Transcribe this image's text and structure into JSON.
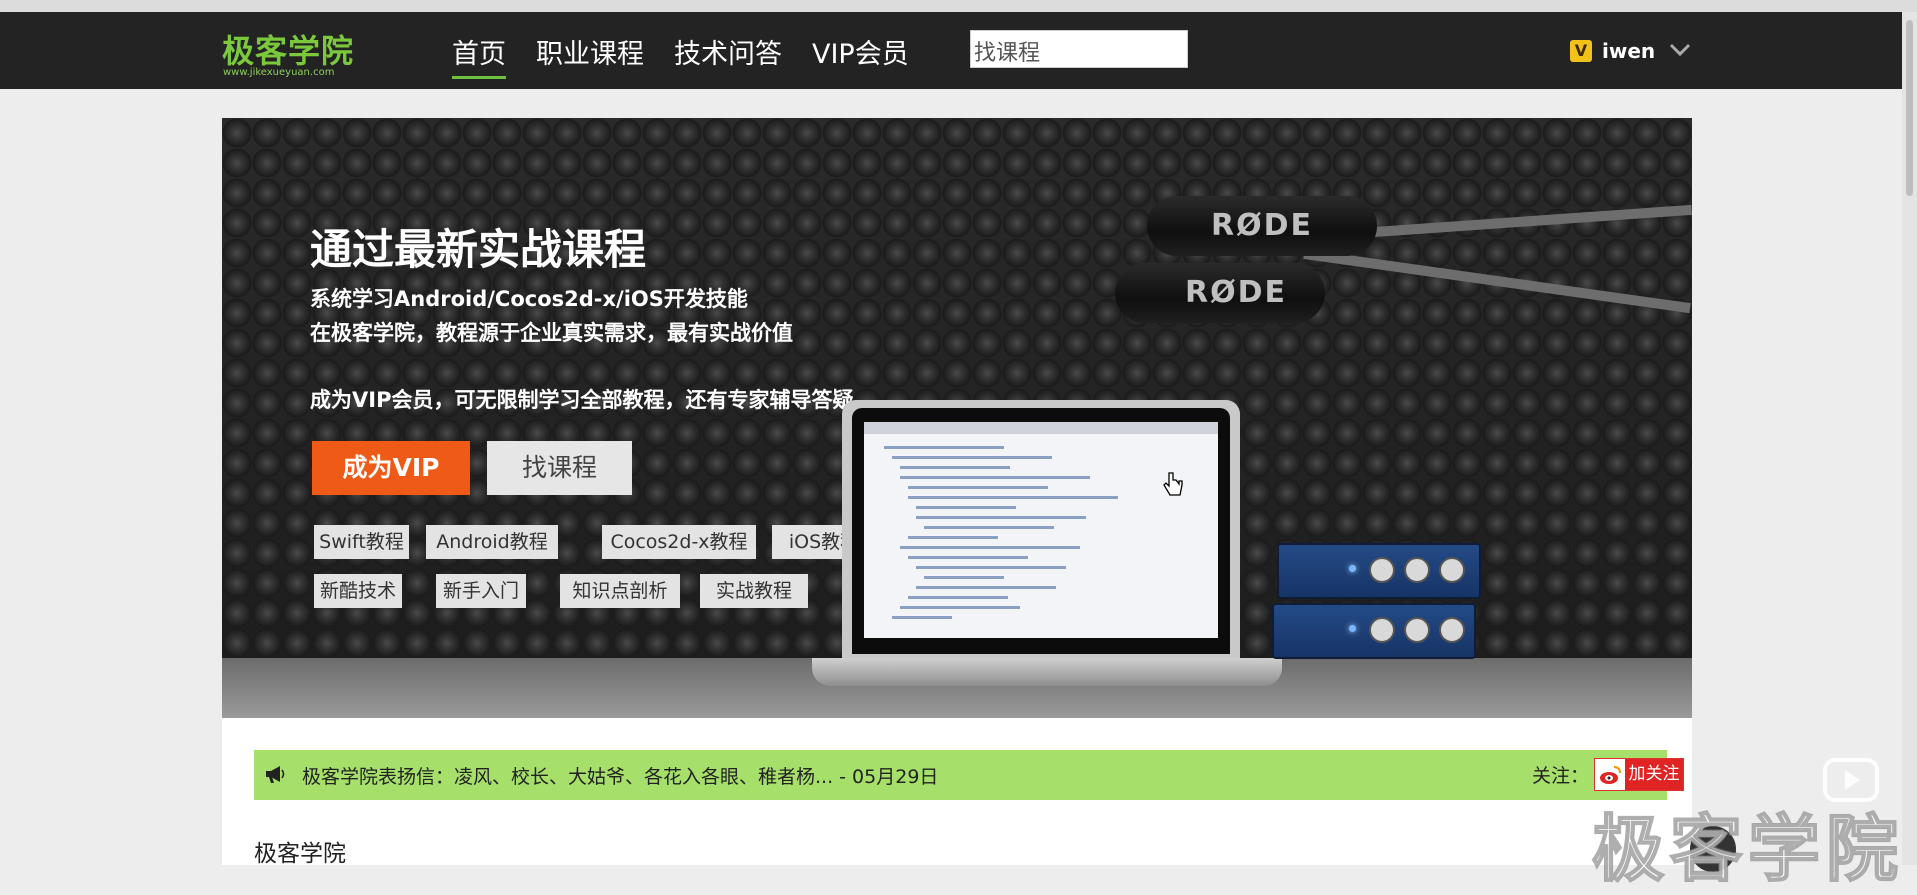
{
  "header": {
    "logo_text": "极客学院",
    "logo_sub": "www.jikexueyuan.com",
    "nav": [
      {
        "label": "首页",
        "active": true
      },
      {
        "label": "职业课程",
        "active": false
      },
      {
        "label": "技术问答",
        "active": false
      },
      {
        "label": "VIP会员",
        "active": false
      }
    ],
    "search_value": "找课程",
    "vip_badge": "V",
    "username": "iwen",
    "user_menu_icon": "chevron-down-icon"
  },
  "banner": {
    "headline": "通过最新实战课程",
    "lines": [
      "系统学习Android/Cocos2d-x/iOS开发技能",
      "在极客学院，教程源于企业真实需求，最有实战价值",
      "成为VIP会员，可无限制学习全部教程，还有专家辅导答疑"
    ],
    "primary_button": "成为VIP",
    "secondary_button": "找课程",
    "tags_row1": [
      "Swift教程",
      "Android教程",
      "Cocos2d-x教程",
      "iOS教程"
    ],
    "tags_row2": [
      "新酷技术",
      "新手入门",
      "知识点剖析",
      "实战教程"
    ],
    "mic_brand": "RØDE",
    "colors": {
      "primary": "#ef5a17",
      "accent": "#7bc93b"
    }
  },
  "notice": {
    "icon": "megaphone-icon",
    "text": "极客学院表扬信：凌风、校长、大姑爷、各花入各眼、稚者杨... - 05月29日",
    "follow_label": "关注：",
    "follow_button": "加关注",
    "follow_icon": "weibo-icon"
  },
  "section": {
    "title": "极客学院"
  },
  "watermark": {
    "text": "极客学院"
  }
}
